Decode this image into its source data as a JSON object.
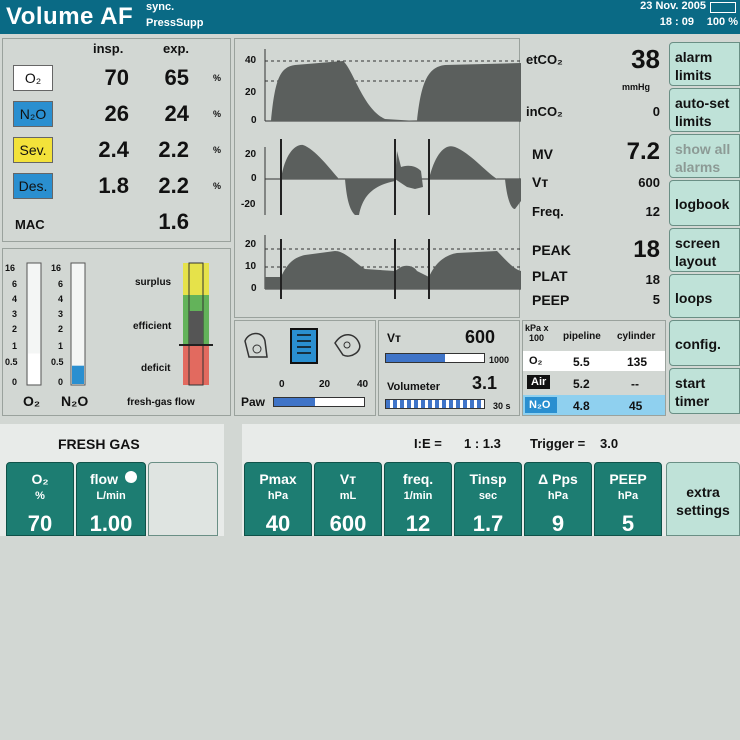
{
  "header": {
    "mode": "Volume AF",
    "sub1": "sync.",
    "sub2": "PressSupp",
    "date": "23 Nov. 2005",
    "time": "18 : 09",
    "battery_pct": "100 %"
  },
  "gases": {
    "col_insp": "insp.",
    "col_exp": "exp.",
    "rows": [
      {
        "label": "O₂",
        "insp": "70",
        "exp": "65",
        "unit": "%",
        "color": "#ffffff"
      },
      {
        "label": "N₂O",
        "insp": "26",
        "exp": "24",
        "unit": "%",
        "color": "#2a8fd0"
      },
      {
        "label": "Sev.",
        "insp": "2.4",
        "exp": "2.2",
        "unit": "%",
        "color": "#f3e23a"
      },
      {
        "label": "Des.",
        "insp": "1.8",
        "exp": "2.2",
        "unit": "%",
        "color": "#2a8fd0"
      }
    ],
    "mac_label": "MAC",
    "mac_value": "1.6"
  },
  "bars": {
    "scale": [
      "16",
      "6",
      "4",
      "3",
      "2",
      "1",
      "0.5",
      "0"
    ],
    "o2_label": "O₂",
    "n2o_label": "N₂O",
    "o2_flow": 0.5,
    "n2o_flow": 0.3,
    "fg_labels": [
      "surplus",
      "efficient",
      "deficit"
    ],
    "fg_caption": "fresh-gas flow"
  },
  "waves": {
    "co2_ticks": [
      "40",
      "20",
      "0"
    ],
    "flow_ticks": [
      "20",
      "0",
      "-20"
    ],
    "paw_ticks": [
      "20",
      "10",
      "0"
    ]
  },
  "readouts": {
    "etco2_label": "etCO₂",
    "etco2": "38",
    "co2_unit": "mmHg",
    "inco2_label": "inCO₂",
    "inco2": "0",
    "mv_label": "MV",
    "mv": "7.2",
    "vt_label": "Vᴛ",
    "vt": "600",
    "freq_label": "Freq.",
    "freq": "12",
    "peak_label": "PEAK",
    "peak": "18",
    "plat_label": "PLAT",
    "plat": "18",
    "peep_label": "PEEP",
    "peep": "5"
  },
  "paw_gauge": {
    "label": "Paw",
    "ticks": [
      "0",
      "20",
      "40"
    ],
    "value_fraction": 0.45
  },
  "vt_meter": {
    "label": "Vᴛ",
    "value": "600",
    "max": "1000",
    "fraction": 0.6
  },
  "volumeter": {
    "label": "Volumeter",
    "value": "3.1",
    "window": "30 s"
  },
  "supply": {
    "unit_top": "kPa x",
    "unit_bottom": "100",
    "col_pipeline": "pipeline",
    "col_cylinder": "cylinder",
    "rows": [
      {
        "gas": "O₂",
        "pipeline": "5.5",
        "cylinder": "135",
        "color": "#ffffff"
      },
      {
        "gas": "Air",
        "pipeline": "5.2",
        "cylinder": "--",
        "color": "#ffffff"
      },
      {
        "gas": "N₂O",
        "pipeline": "4.8",
        "cylinder": "45",
        "color": "#2a8fd0"
      }
    ]
  },
  "right_buttons": [
    {
      "label": "alarm limits",
      "enabled": true
    },
    {
      "label": "auto-set limits",
      "enabled": true
    },
    {
      "label": "show all alarms",
      "enabled": false
    },
    {
      "label": "logbook",
      "enabled": true
    },
    {
      "label": "screen layout",
      "enabled": true
    },
    {
      "label": "loops",
      "enabled": true
    },
    {
      "label": "config.",
      "enabled": true
    },
    {
      "label": "start timer",
      "enabled": true
    }
  ],
  "fresh_gas": {
    "title": "FRESH GAS",
    "o2": {
      "name": "O₂",
      "unit": "%",
      "value": "70"
    },
    "flow": {
      "name": "flow",
      "unit": "L/min",
      "value": "1.00"
    }
  },
  "vent_status": {
    "ie_label": "I:E =",
    "ie_value": "1 : 1.3",
    "trigger_label": "Trigger =",
    "trigger_value": "3.0"
  },
  "vent_settings": [
    {
      "name": "Pmax",
      "unit": "hPa",
      "value": "40"
    },
    {
      "name": "Vᴛ",
      "unit": "mL",
      "value": "600"
    },
    {
      "name": "freq.",
      "unit": "1/min",
      "value": "12"
    },
    {
      "name": "Tinsp",
      "unit": "sec",
      "value": "1.7"
    },
    {
      "name": "Δ Pps",
      "unit": "hPa",
      "value": "9"
    },
    {
      "name": "PEEP",
      "unit": "hPa",
      "value": "5"
    }
  ],
  "extra_settings": "extra settings"
}
